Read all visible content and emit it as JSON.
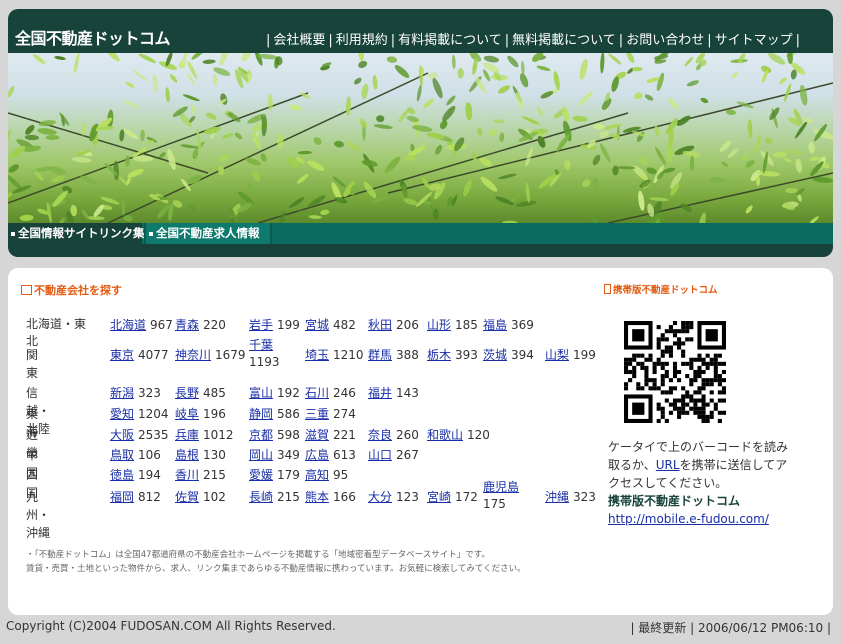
{
  "header": {
    "logo": "全国不動産ドットコム",
    "nav": [
      "会社概要",
      "利用規約",
      "有料掲載について",
      "無料掲載について",
      "お問い合わせ",
      "サイトマップ"
    ],
    "tabs": [
      "全国情報サイトリンク集",
      "全国不動産求人情報"
    ]
  },
  "search_section": {
    "title": "不動産会社を探す"
  },
  "regions": [
    {
      "name": "北海道・東北",
      "prefs": [
        {
          "name": "北海道",
          "count": "967"
        },
        {
          "name": "青森",
          "count": "220"
        },
        {
          "name": "岩手",
          "count": "199"
        },
        {
          "name": "宮城",
          "count": "482"
        },
        {
          "name": "秋田",
          "count": "206"
        },
        {
          "name": "山形",
          "count": "185"
        },
        {
          "name": "福島",
          "count": "369"
        }
      ]
    },
    {
      "name": "関東",
      "prefs": [
        {
          "name": "東京",
          "count": "4077"
        },
        {
          "name": "神奈川",
          "count": "1679"
        },
        {
          "name": "千葉",
          "count": "1193"
        },
        {
          "name": "埼玉",
          "count": "1210"
        },
        {
          "name": "群馬",
          "count": "388"
        },
        {
          "name": "栃木",
          "count": "393"
        },
        {
          "name": "茨城",
          "count": "394"
        },
        {
          "name": "山梨",
          "count": "199"
        }
      ]
    },
    {
      "name": "信越・北陸",
      "prefs": [
        {
          "name": "新潟",
          "count": "323"
        },
        {
          "name": "長野",
          "count": "485"
        },
        {
          "name": "富山",
          "count": "192"
        },
        {
          "name": "石川",
          "count": "246"
        },
        {
          "name": "福井",
          "count": "143"
        }
      ]
    },
    {
      "name": "東海",
      "prefs": [
        {
          "name": "愛知",
          "count": "1204"
        },
        {
          "name": "岐阜",
          "count": "196"
        },
        {
          "name": "静岡",
          "count": "586"
        },
        {
          "name": "三重",
          "count": "274"
        }
      ]
    },
    {
      "name": "近畿",
      "prefs": [
        {
          "name": "大阪",
          "count": "2535"
        },
        {
          "name": "兵庫",
          "count": "1012"
        },
        {
          "name": "京都",
          "count": "598"
        },
        {
          "name": "滋賀",
          "count": "221"
        },
        {
          "name": "奈良",
          "count": "260"
        },
        {
          "name": "和歌山",
          "count": "120"
        }
      ]
    },
    {
      "name": "中国",
      "prefs": [
        {
          "name": "鳥取",
          "count": "106"
        },
        {
          "name": "島根",
          "count": "130"
        },
        {
          "name": "岡山",
          "count": "349"
        },
        {
          "name": "広島",
          "count": "613"
        },
        {
          "name": "山口",
          "count": "267"
        }
      ]
    },
    {
      "name": "四国",
      "prefs": [
        {
          "name": "徳島",
          "count": "194"
        },
        {
          "name": "香川",
          "count": "215"
        },
        {
          "name": "愛媛",
          "count": "179"
        },
        {
          "name": "高知",
          "count": "95"
        }
      ]
    },
    {
      "name": "九州・沖縄",
      "prefs": [
        {
          "name": "福岡",
          "count": "812"
        },
        {
          "name": "佐賀",
          "count": "102"
        },
        {
          "name": "長崎",
          "count": "215"
        },
        {
          "name": "熊本",
          "count": "166"
        },
        {
          "name": "大分",
          "count": "123"
        },
        {
          "name": "宮崎",
          "count": "172"
        },
        {
          "name": "鹿児島",
          "count": "175"
        },
        {
          "name": "沖縄",
          "count": "323"
        }
      ]
    }
  ],
  "note": {
    "line1": "・「不動産ドットコム」は全国47都道府県の不動産会社ホームページを掲載する「地域密着型データベースサイト」です。",
    "line2": "賃貸・売買・土地といった物件から、求人、リンク集まであらゆる不動産情報に携わっています。お気軽に検索してみてください。"
  },
  "mobile": {
    "title": "携帯版不動産ドットコム",
    "text1": "ケータイで上のバーコードを読み取るか、",
    "url_label": "URL",
    "text2": "を携帯に送信してアクセスしてください。",
    "name": "携帯版不動産ドットコム",
    "link": "http://mobile.e-fudou.com/"
  },
  "footer": {
    "copyright": "Copyright (C)2004 FUDOSAN.COM All Rights Reserved.",
    "updated": "| 最終更新 | 2006/06/12 PM06:10 |"
  },
  "colors": {
    "header_bg": "#17433a",
    "subnav_bg": "#0c6b61",
    "accent": "#e35a12",
    "link": "#1a2fa8"
  }
}
